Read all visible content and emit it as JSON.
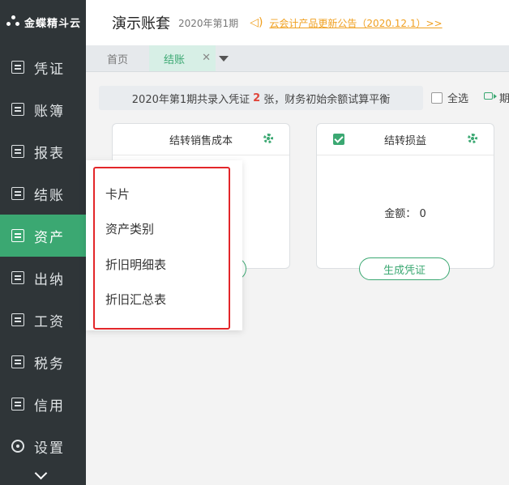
{
  "brand": {
    "name": "金蝶精斗云"
  },
  "sidebar": {
    "items": [
      {
        "label": "凭证",
        "icon": "edit-icon"
      },
      {
        "label": "账簿",
        "icon": "book-icon"
      },
      {
        "label": "报表",
        "icon": "report-icon"
      },
      {
        "label": "结账",
        "icon": "checkbox-icon"
      },
      {
        "label": "资产",
        "icon": "asset-icon",
        "active": true
      },
      {
        "label": "出纳",
        "icon": "cashier-icon"
      },
      {
        "label": "工资",
        "icon": "salary-icon"
      },
      {
        "label": "税务",
        "icon": "tax-icon"
      },
      {
        "label": "信用",
        "icon": "credit-icon"
      },
      {
        "label": "设置",
        "icon": "gear-icon"
      }
    ],
    "expand_icon": "chevron-down-icon"
  },
  "header": {
    "title": "演示账套",
    "period": "2020年第1期",
    "notice_icon": "speaker-icon",
    "notice": "云会计产品更新公告（2020.12.1）>>"
  },
  "tabs": [
    {
      "label": "首页"
    },
    {
      "label": "结账",
      "active": true
    }
  ],
  "info_bar": {
    "prefix": "2020年第1期共录入凭证",
    "count": "2",
    "suffix": "张，财务初始余额试算平衡"
  },
  "toolbar": {
    "select_all": "全选",
    "period_cut": "期"
  },
  "cards": [
    {
      "title": "结转销售成本"
    },
    {
      "title": "结转损益",
      "amount_label": "金额：",
      "amount": "0",
      "button": "生成凭证",
      "checked": true
    }
  ],
  "asset_menu": {
    "items": [
      {
        "label": "卡片"
      },
      {
        "label": "资产类别"
      },
      {
        "label": "折旧明细表"
      },
      {
        "label": "折旧汇总表"
      }
    ]
  },
  "colors": {
    "accent": "#3ba872",
    "sidebar_bg": "#2f3538",
    "notice": "#f0a020",
    "highlight": "#e3262a",
    "count": "#e0453a"
  }
}
